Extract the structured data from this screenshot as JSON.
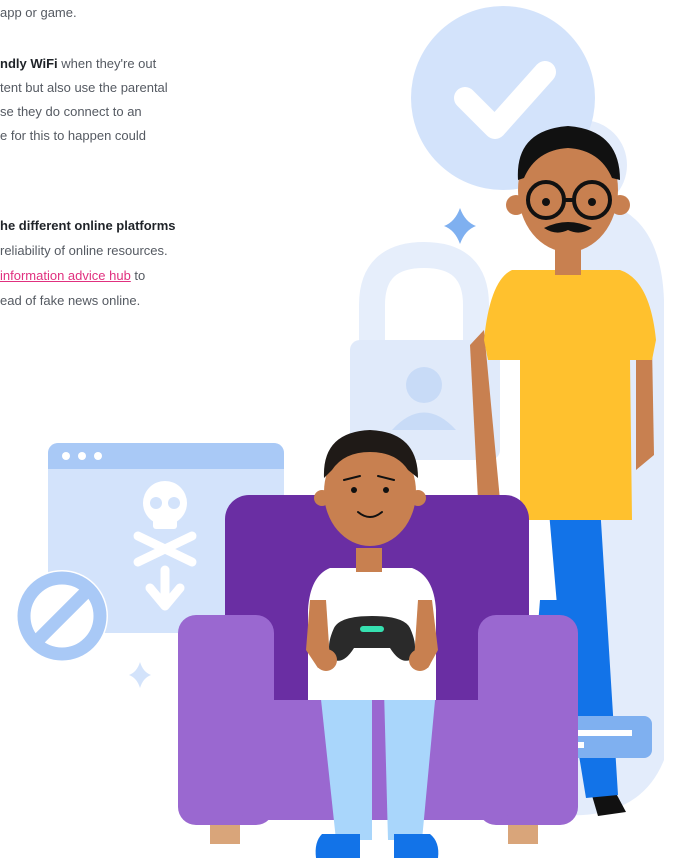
{
  "paragraphs": {
    "p1_line1": "app or game.",
    "p2_bold": "ndly WiFi",
    "p2_line1_rest": " when they're out",
    "p2_line2": "tent but also use the parental",
    "p2_line3": "se they do connect to an",
    "p2_line4": "e for this to happen could",
    "p3_bold": "he different online platforms",
    "p3_line2": "reliability of online resources.",
    "p3_link": "information advice hub",
    "p3_line3_rest": " to",
    "p3_line4": "ead of fake news online."
  },
  "colors": {
    "text": "#555a62",
    "bold_text": "#1f2328",
    "link": "#e0307f",
    "pale_blue": "#d3e3fb",
    "light_blue": "#a9c9f6",
    "mid_blue": "#7fb0f0",
    "chair_dark": "#6a2ea3",
    "chair_light": "#9a68d0",
    "shirt_yellow": "#ffc12e",
    "trousers_blue": "#1273e8",
    "skin": "#c88050"
  },
  "icons": {
    "check": "check-circle-icon",
    "lock": "padlock-icon",
    "browser": "browser-window-icon",
    "skull": "skull-crossbones-icon",
    "block": "prohibited-icon",
    "sparkle": "sparkle-icon",
    "chat": "chat-bubble-icon",
    "controller": "game-controller-icon"
  }
}
